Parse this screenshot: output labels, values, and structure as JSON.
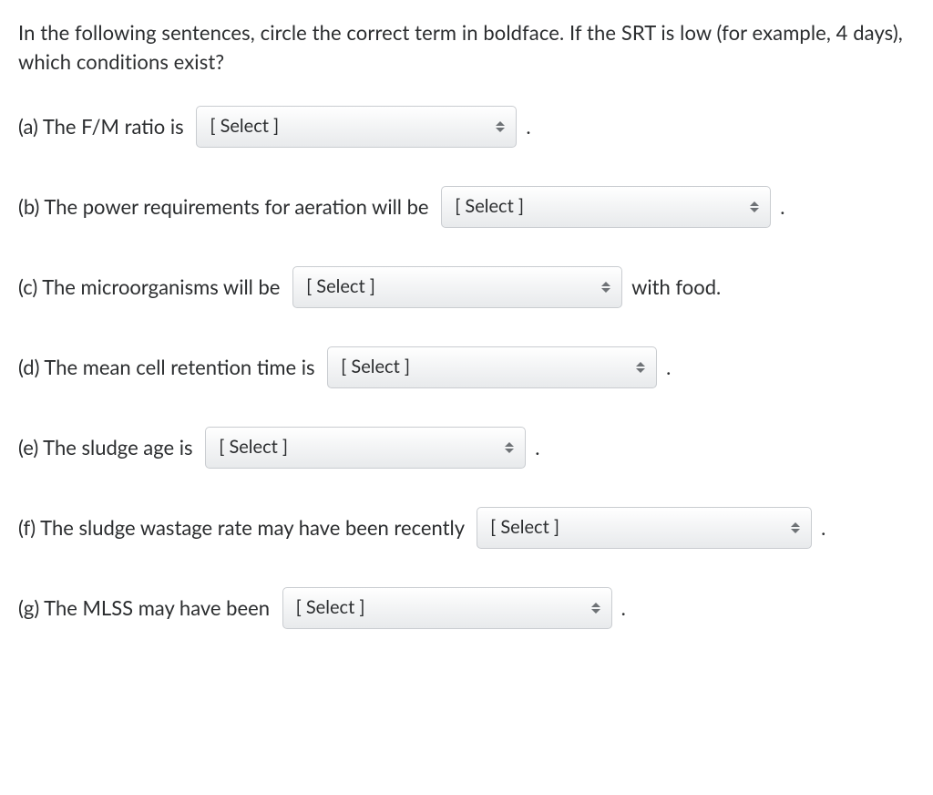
{
  "intro": "In the following sentences, circle the correct term in boldface. If the SRT is low (for example, 4 days), which conditions exist?",
  "select_placeholder": "[ Select ]",
  "questions": {
    "a": {
      "before": "(a) The F/M ratio is ",
      "after": " ."
    },
    "b": {
      "before": "(b) The power requirements for aeration will be ",
      "after": " ."
    },
    "c": {
      "before": "(c) The microorganisms will be ",
      "after": " with food."
    },
    "d": {
      "before": "(d) The mean cell retention time is ",
      "after": " ."
    },
    "e": {
      "before": "(e) The sludge age is ",
      "after": " ."
    },
    "f": {
      "before": "(f) The sludge wastage rate may have been recently ",
      "after": " ."
    },
    "g": {
      "before": "(g) The MLSS may have been ",
      "after": " ."
    }
  }
}
